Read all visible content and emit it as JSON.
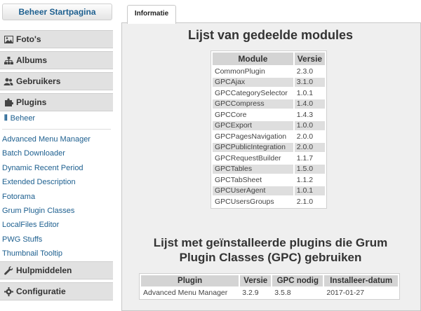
{
  "sidebar": {
    "home_button": "Beheer Startpagina",
    "sections": {
      "photos": "Foto's",
      "albums": "Albums",
      "users": "Gebruikers",
      "plugins": "Plugins",
      "tools": "Hulpmiddelen",
      "configuration": "Configuratie"
    },
    "plugins_active_item": "Beheer",
    "plugin_items": [
      "Advanced Menu Manager",
      "Batch Downloader",
      "Dynamic Recent Period",
      "Extended Description",
      "Fotorama",
      "Grum Plugin Classes",
      "LocalFiles Editor",
      "PWG Stuffs",
      "Thumbnail Tooltip"
    ]
  },
  "tab": {
    "label": "Informatie"
  },
  "modules": {
    "title": "Lijst van gedeelde modules",
    "headers": [
      "Module",
      "Versie"
    ],
    "rows": [
      [
        "CommonPlugin",
        "2.3.0"
      ],
      [
        "GPCAjax",
        "3.1.0"
      ],
      [
        "GPCCategorySelector",
        "1.0.1"
      ],
      [
        "GPCCompress",
        "1.4.0"
      ],
      [
        "GPCCore",
        "1.4.3"
      ],
      [
        "GPCExport",
        "1.0.0"
      ],
      [
        "GPCPagesNavigation",
        "2.0.0"
      ],
      [
        "GPCPublicIntegration",
        "2.0.0"
      ],
      [
        "GPCRequestBuilder",
        "1.1.7"
      ],
      [
        "GPCTables",
        "1.5.0"
      ],
      [
        "GPCTabSheet",
        "1.1.2"
      ],
      [
        "GPCUserAgent",
        "1.0.1"
      ],
      [
        "GPCUsersGroups",
        "2.1.0"
      ]
    ]
  },
  "plugins": {
    "title_line1": "Lijst met geïnstalleerde plugins die Grum",
    "title_line2": "Plugin Classes (GPC) gebruiken",
    "headers": [
      "Plugin",
      "Versie",
      "GPC nodig",
      "Installeer-datum"
    ],
    "rows": [
      [
        "Advanced Menu Manager",
        "3.2.9",
        "3.5.8",
        "2017-01-27"
      ]
    ]
  }
}
